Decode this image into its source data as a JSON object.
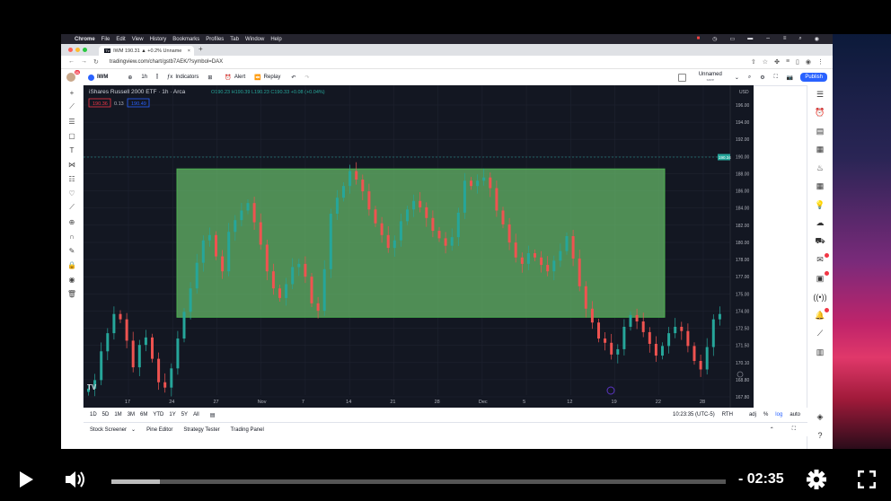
{
  "mac_menubar": {
    "app": "Chrome",
    "items": [
      "File",
      "Edit",
      "View",
      "History",
      "Bookmarks",
      "Profiles",
      "Tab",
      "Window",
      "Help"
    ]
  },
  "browser": {
    "tab_title": "IWM 190.31 ▲ +0.2% Unname",
    "url": "tradingview.com/chart/gstb7AEK/?symbol=DAX"
  },
  "tv_toolbar": {
    "avatar_badge": "11",
    "symbol": "IWM",
    "interval": "1h",
    "indicators": "Indicators",
    "alert": "Alert",
    "replay": "Replay",
    "layout_name": "Unnamed",
    "layout_sub": "save",
    "publish": "Publish"
  },
  "legend": {
    "title": "iShares Russell 2000 ETF · 1h · Arca",
    "ohlc": "O190.23 H190.39 L190.23 C190.33 +0.08 (+0.04%)",
    "sell": "190.36",
    "spread": "0.13",
    "buy": "190.49"
  },
  "chart_data": {
    "type": "candlestick",
    "title": "iShares Russell 2000 ETF · 1h · Arca",
    "currency": "USD",
    "last_price_label": "190.34",
    "x_tick_labels": [
      "17",
      "24",
      "27",
      "Nov",
      "7",
      "14",
      "21",
      "28",
      "Dec",
      "5",
      "12",
      "19",
      "22",
      "28"
    ],
    "y_tick_labels": [
      "196.00",
      "194.00",
      "192.00",
      "190.00",
      "188.00",
      "186.00",
      "184.00",
      "182.00",
      "180.00",
      "178.00",
      "177.00",
      "175.00",
      "174.00",
      "172.50",
      "171.50",
      "170.10",
      "168.80",
      "167.80"
    ],
    "ylim": [
      167.8,
      196.0
    ],
    "rectangle_zone": {
      "top": 189.0,
      "bottom": 175.1,
      "color": "#66bb6a"
    },
    "price_path": [
      168.4,
      169.2,
      171.9,
      173.6,
      175.4,
      174.9,
      172.9,
      170.4,
      172.5,
      173.2,
      171.2,
      169.0,
      168.5,
      170.3,
      173.1,
      175.6,
      177.8,
      180.2,
      182.3,
      182.8,
      180.8,
      179.4,
      183.1,
      184.2,
      185.1,
      185.8,
      184.0,
      181.9,
      179.4,
      177.8,
      176.9,
      178.2,
      179.8,
      180.1,
      178.9,
      176.4,
      175.7,
      179.6,
      184.8,
      186.3,
      187.4,
      188.8,
      188.0,
      186.9,
      185.2,
      183.9,
      182.8,
      181.6,
      182.3,
      184.1,
      185.2,
      186.0,
      185.4,
      184.4,
      183.2,
      182.5,
      181.8,
      182.6,
      184.9,
      187.9,
      187.4,
      187.9,
      188.2,
      187.2,
      185.1,
      183.8,
      182.1,
      180.7,
      180.1,
      181.1,
      180.7,
      180.0,
      179.4,
      180.4,
      181.3,
      182.7,
      180.6,
      178.0,
      175.9,
      174.6,
      173.1,
      172.7,
      171.6,
      172.1,
      174.2,
      175.3,
      174.7,
      173.7,
      172.6,
      171.5,
      172.4,
      173.6,
      174.2,
      173.8,
      172.4,
      171.0,
      170.2,
      172.3,
      174.9,
      175.4
    ]
  },
  "bottom": {
    "ranges": [
      "1D",
      "5D",
      "1M",
      "3M",
      "6M",
      "YTD",
      "1Y",
      "5Y",
      "All"
    ],
    "time": "10:23:35 (UTC-5)",
    "rth": "RTH",
    "adj": "adj",
    "pct": "%",
    "log": "log",
    "auto": "auto"
  },
  "panels": [
    "Stock Screener",
    "Pine Editor",
    "Strategy Tester",
    "Trading Panel"
  ],
  "player": {
    "time": "- 02:35",
    "progress": 0.079
  }
}
